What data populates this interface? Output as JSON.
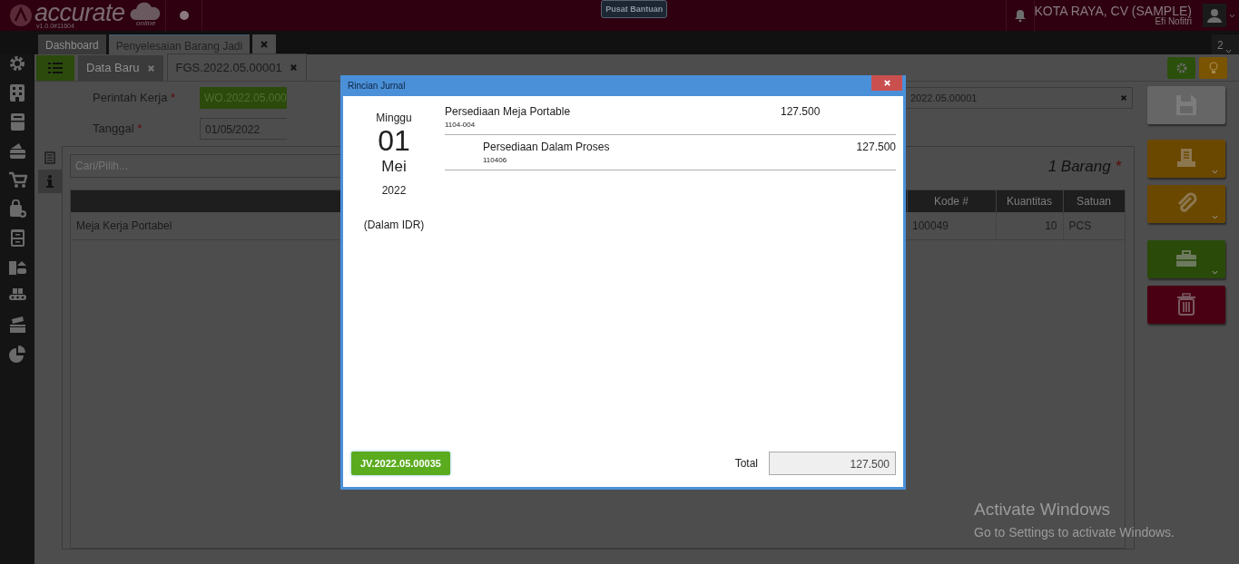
{
  "app": {
    "logo": "accurate",
    "logo_sub": "online",
    "version": "v1.0.0#11604",
    "help_button": "Pusat Bantuan",
    "company": "KOTA RAYA, CV (SAMPLE)",
    "user": "Efi Nofitri",
    "window_count": "2"
  },
  "main_tabs": [
    {
      "label": "Dashboard",
      "selected": false,
      "closable": false
    },
    {
      "label": "Penyelesaian Barang Jadi",
      "selected": true,
      "closable": true
    }
  ],
  "sub_tabs": [
    {
      "label": "Data Baru",
      "selected": false
    },
    {
      "label": "FGS.2022.05.00001",
      "selected": true
    }
  ],
  "form": {
    "fields": [
      {
        "label": "Perintah Kerja",
        "required_mark": "*",
        "value": "WO.2022.05.000",
        "kind": "lookup"
      },
      {
        "label": "Tanggal",
        "required_mark": "*",
        "value": "01/05/2022",
        "kind": "date"
      }
    ],
    "reference_value": "2022.05.00001"
  },
  "detail": {
    "search_placeholder": "Cari/Pilih...",
    "count": "1 Barang",
    "count_mark": "*",
    "columns": [
      "Kode #",
      "Kuantitas",
      "Satuan"
    ],
    "rows": [
      {
        "name": "Meja Kerja Portabel",
        "code": "100049",
        "quantity": "10",
        "unit": "PCS"
      }
    ]
  },
  "dialog": {
    "title": "Rincian Jurnal",
    "day": "Minggu",
    "date": "01",
    "month": "Mei",
    "year": "2022",
    "currency": "(Dalam IDR)",
    "entries": [
      {
        "account": "Persediaan Meja Portable",
        "code": "1104-004",
        "indented": false,
        "amount": "127.500"
      },
      {
        "account": "Persediaan Dalam Proses",
        "code": "110406",
        "indented": true,
        "amount": "127.500"
      }
    ],
    "voucher_button": "JV.2022.05.00035",
    "total_label": "Total",
    "total": "127.500"
  },
  "watermark": {
    "title": "Activate Windows",
    "subtitle": "Go to Settings to activate Windows."
  }
}
